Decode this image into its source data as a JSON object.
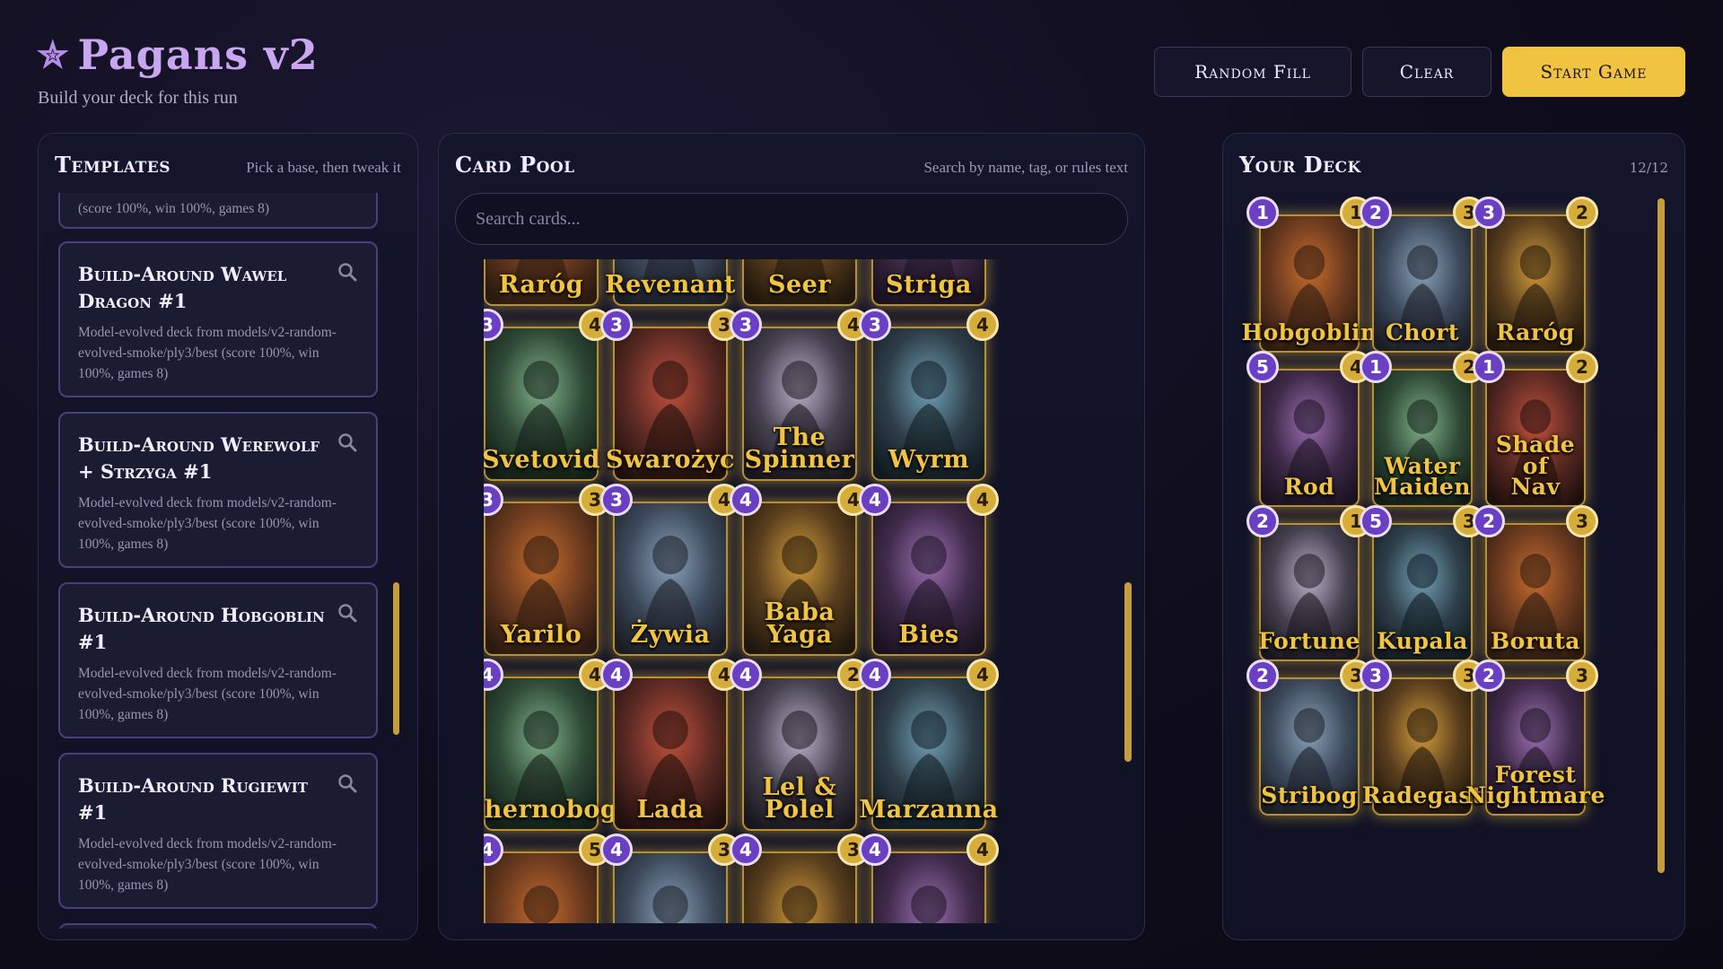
{
  "app": {
    "title": "Pagans v2",
    "subtitle": "Build your deck for this run",
    "star_icon": "star-icon"
  },
  "actions": {
    "random_fill": "Random Fill",
    "clear": "Clear",
    "start_game": "Start Game"
  },
  "colors": {
    "accent_gold": "#f0c341",
    "accent_purple": "#6a3fc4",
    "panel_border": "#2f2a4c",
    "title_purple": "#c9a6f0"
  },
  "templates": {
    "title": "Templates",
    "hint": "Pick a base, then tweak it",
    "items": [
      {
        "name": "",
        "desc": "(score 100%, win 100%, games 8)"
      },
      {
        "name": "Build-Around Wawel Dragon #1",
        "desc": "Model-evolved deck from models/v2-random-evolved-smoke/ply3/best (score 100%, win 100%, games 8)"
      },
      {
        "name": "Build-Around Werewolf + Strzyga #1",
        "desc": "Model-evolved deck from models/v2-random-evolved-smoke/ply3/best (score 100%, win 100%, games 8)"
      },
      {
        "name": "Build-Around Hobgoblin #1",
        "desc": "Model-evolved deck from models/v2-random-evolved-smoke/ply3/best (score 100%, win 100%, games 8)"
      },
      {
        "name": "Build-Around Rugiewit #1",
        "desc": "Model-evolved deck from models/v2-random-evolved-smoke/ply3/best (score 100%, win 100%, games 8)"
      }
    ]
  },
  "pool": {
    "title": "Card Pool",
    "hint": "Search by name, tag, or rules text",
    "search_placeholder": "Search cards...",
    "cards": [
      {
        "name": "Raróg",
        "cost": null,
        "power": null
      },
      {
        "name": "Revenant",
        "cost": null,
        "power": null
      },
      {
        "name": "Seer",
        "cost": null,
        "power": null
      },
      {
        "name": "Striga",
        "cost": null,
        "power": null
      },
      {
        "name": "Svetovid",
        "cost": "3",
        "power": "4"
      },
      {
        "name": "Swarożyc",
        "cost": "3",
        "power": "3"
      },
      {
        "name": "The\nSpinner",
        "cost": "3",
        "power": "4"
      },
      {
        "name": "Wyrm",
        "cost": "3",
        "power": "4"
      },
      {
        "name": "Yarilo",
        "cost": "3",
        "power": "3"
      },
      {
        "name": "Żywia",
        "cost": "3",
        "power": "4"
      },
      {
        "name": "Baba\nYaga",
        "cost": "4",
        "power": "4"
      },
      {
        "name": "Bies",
        "cost": "4",
        "power": "4"
      },
      {
        "name": "Chernobog",
        "cost": "4",
        "power": "4"
      },
      {
        "name": "Lada",
        "cost": "4",
        "power": "4"
      },
      {
        "name": "Lel &\nPolel",
        "cost": "4",
        "power": "2"
      },
      {
        "name": "Marzanna",
        "cost": "4",
        "power": "4"
      },
      {
        "name": "",
        "cost": "4",
        "power": "5"
      },
      {
        "name": "",
        "cost": "4",
        "power": "3"
      },
      {
        "name": "",
        "cost": "4",
        "power": "3"
      },
      {
        "name": "",
        "cost": "4",
        "power": "4"
      }
    ]
  },
  "deck": {
    "title": "Your Deck",
    "count": "12/12",
    "cards": [
      {
        "name": "Hobgoblin",
        "cost": "1",
        "power": "1"
      },
      {
        "name": "Chort",
        "cost": "2",
        "power": "3"
      },
      {
        "name": "Raróg",
        "cost": "3",
        "power": "2"
      },
      {
        "name": "Rod",
        "cost": "5",
        "power": "4"
      },
      {
        "name": "Water\nMaiden",
        "cost": "1",
        "power": "2"
      },
      {
        "name": "Shade\nof\nNav",
        "cost": "1",
        "power": "2"
      },
      {
        "name": "Fortune",
        "cost": "2",
        "power": "1"
      },
      {
        "name": "Kupala",
        "cost": "5",
        "power": "3"
      },
      {
        "name": "Boruta",
        "cost": "2",
        "power": "3"
      },
      {
        "name": "Stribog",
        "cost": "2",
        "power": "3"
      },
      {
        "name": "Radegast",
        "cost": "3",
        "power": "3"
      },
      {
        "name": "Forest\nNightmare",
        "cost": "2",
        "power": "3"
      }
    ]
  }
}
